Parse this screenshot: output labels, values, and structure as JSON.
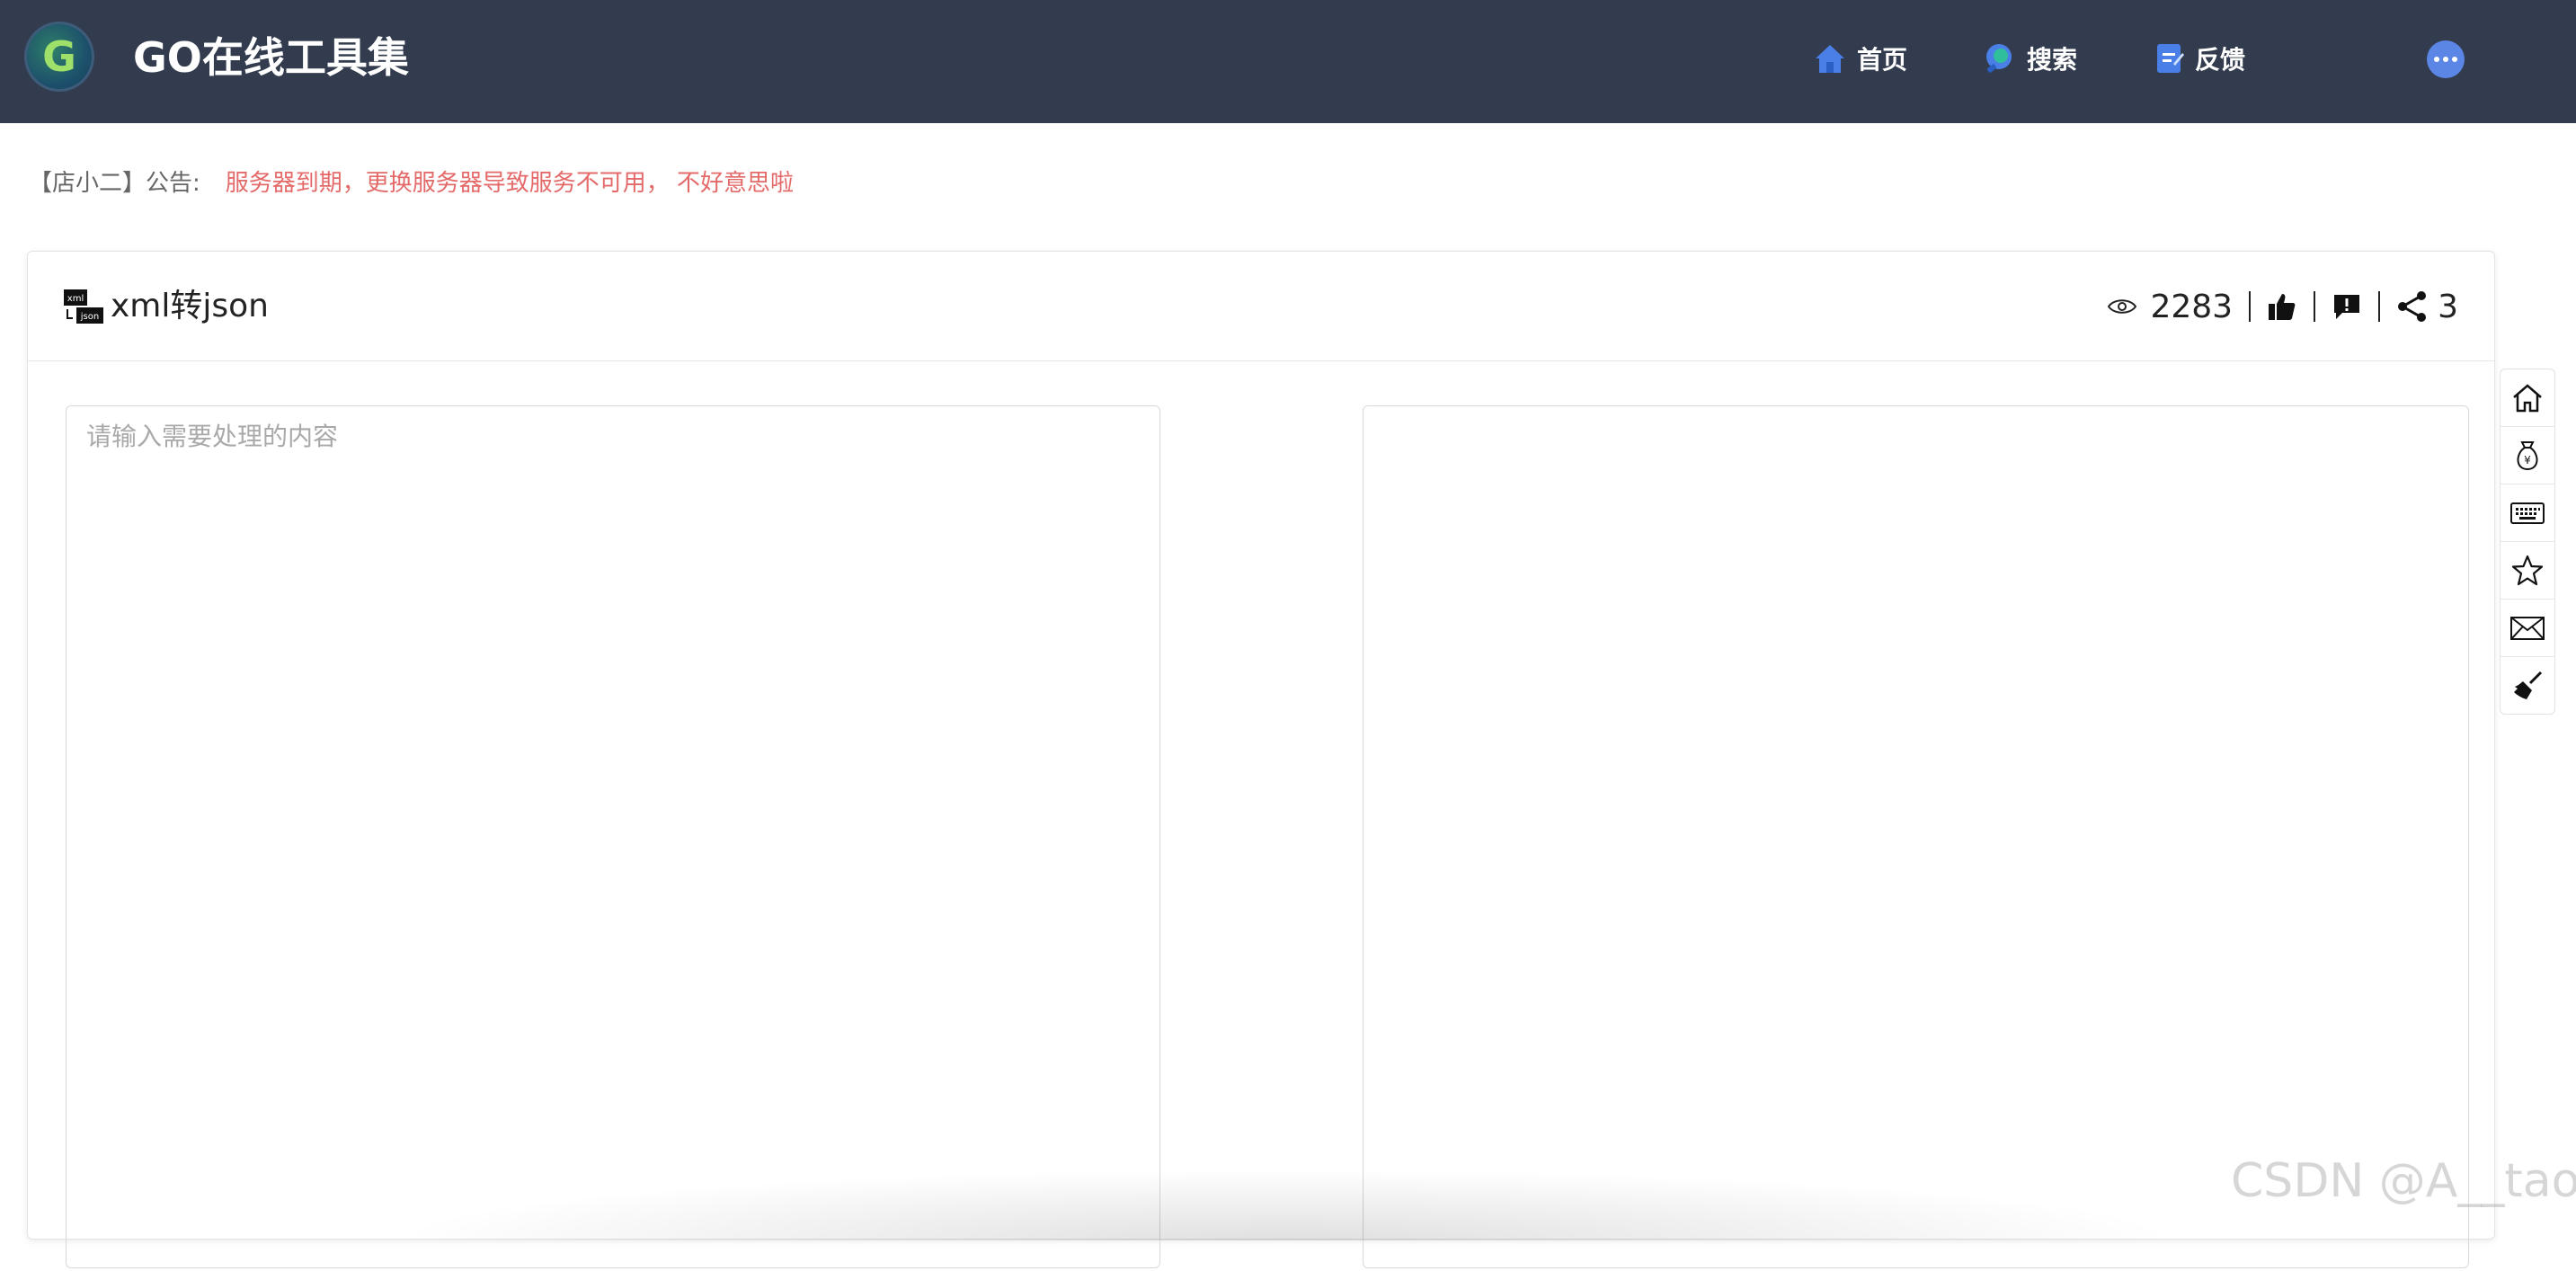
{
  "header": {
    "logo_letter": "G",
    "site_title": "GO在线工具集",
    "nav": [
      {
        "label": "首页",
        "icon": "home-icon"
      },
      {
        "label": "搜索",
        "icon": "search-icon"
      },
      {
        "label": "反馈",
        "icon": "feedback-icon"
      }
    ],
    "more_icon": "more-icon"
  },
  "announcement": {
    "label": "【店小二】公告:",
    "text": "服务器到期，更换服务器导致服务不可用， 不好意思啦"
  },
  "tool": {
    "title": "xml转json",
    "views": "2283",
    "shares": "3"
  },
  "input": {
    "placeholder": "请输入需要处理的内容",
    "value": ""
  },
  "output": {
    "value": ""
  },
  "side_toolbar": [
    "home-icon",
    "money-bag-icon",
    "keyboard-icon",
    "star-icon",
    "mail-icon",
    "broom-icon"
  ],
  "watermark": "CSDN @A__tao",
  "colors": {
    "header_bg": "#323c4e",
    "announce_text": "#e46a6a",
    "accent": "#5b86e5"
  }
}
